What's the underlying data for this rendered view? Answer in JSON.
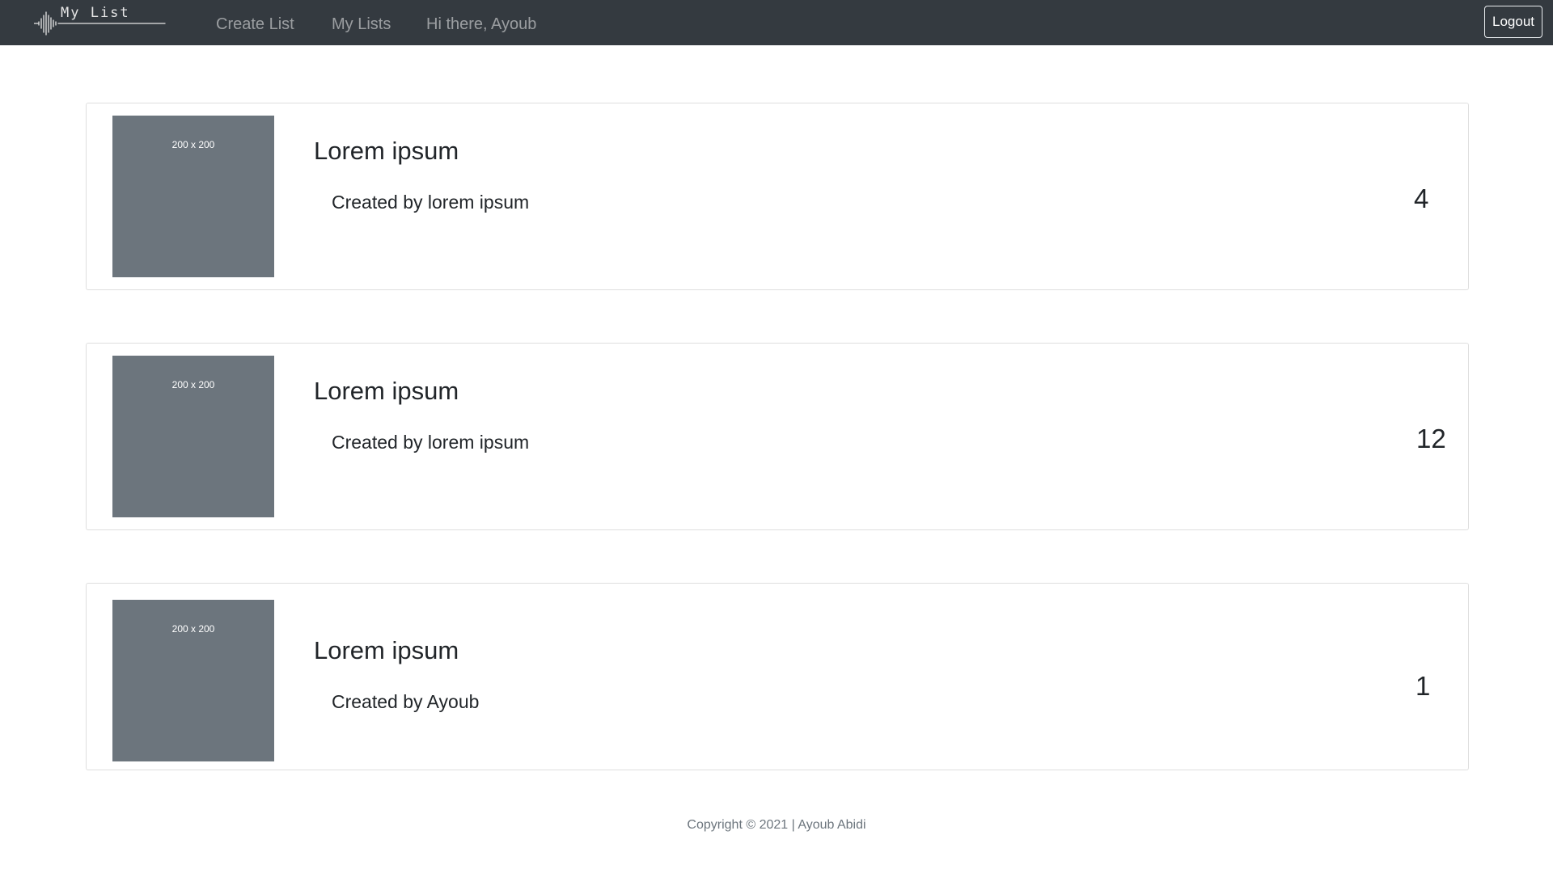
{
  "nav": {
    "brand": "My List",
    "links": [
      {
        "label": "Create List"
      },
      {
        "label": "My Lists"
      }
    ],
    "greeting": "Hi there, Ayoub",
    "logout_label": "Logout",
    "background_color": "#343a40"
  },
  "lists": [
    {
      "title": "Lorem ipsum",
      "created_by": "Created by lorem ipsum",
      "count": "4",
      "image_label": "200 x 200"
    },
    {
      "title": "Lorem ipsum",
      "created_by": "Created by lorem ipsum",
      "count": "12",
      "image_label": "200 x 200"
    },
    {
      "title": "Lorem ipsum",
      "created_by": "Created by Ayoub",
      "count": "1",
      "image_label": "200 x 200"
    }
  ],
  "placeholder_color": "#6c757d",
  "footer": {
    "copyright": "Copyright © 2021 | Ayoub Abidi"
  }
}
